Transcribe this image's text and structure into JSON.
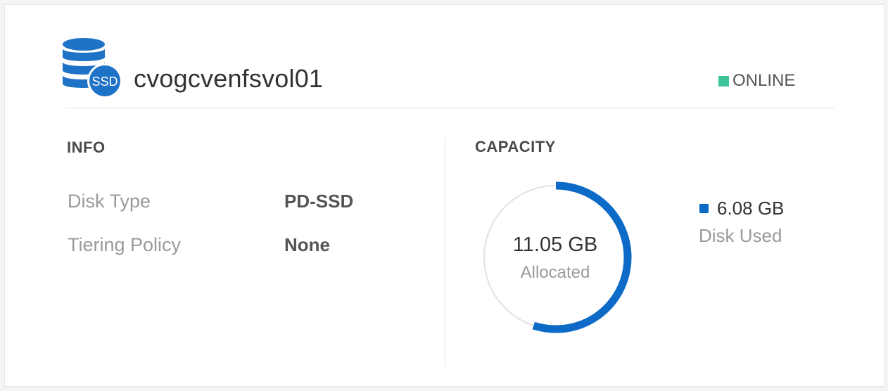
{
  "volume": {
    "name": "cvogcvenfsvol01",
    "icon": "database-ssd-icon",
    "icon_badge": "SSD",
    "status": "ONLINE",
    "status_color": "#3cc39a",
    "accent_color": "#0d6bc7"
  },
  "info": {
    "title": "INFO",
    "rows": [
      {
        "label": "Disk Type",
        "value": "PD-SSD"
      },
      {
        "label": "Tiering Policy",
        "value": "None"
      }
    ]
  },
  "capacity": {
    "title": "CAPACITY",
    "allocated_value": "11.05 GB",
    "allocated_label": "Allocated",
    "used_value": "6.08 GB",
    "used_label": "Disk Used",
    "used_fraction": 0.55
  }
}
